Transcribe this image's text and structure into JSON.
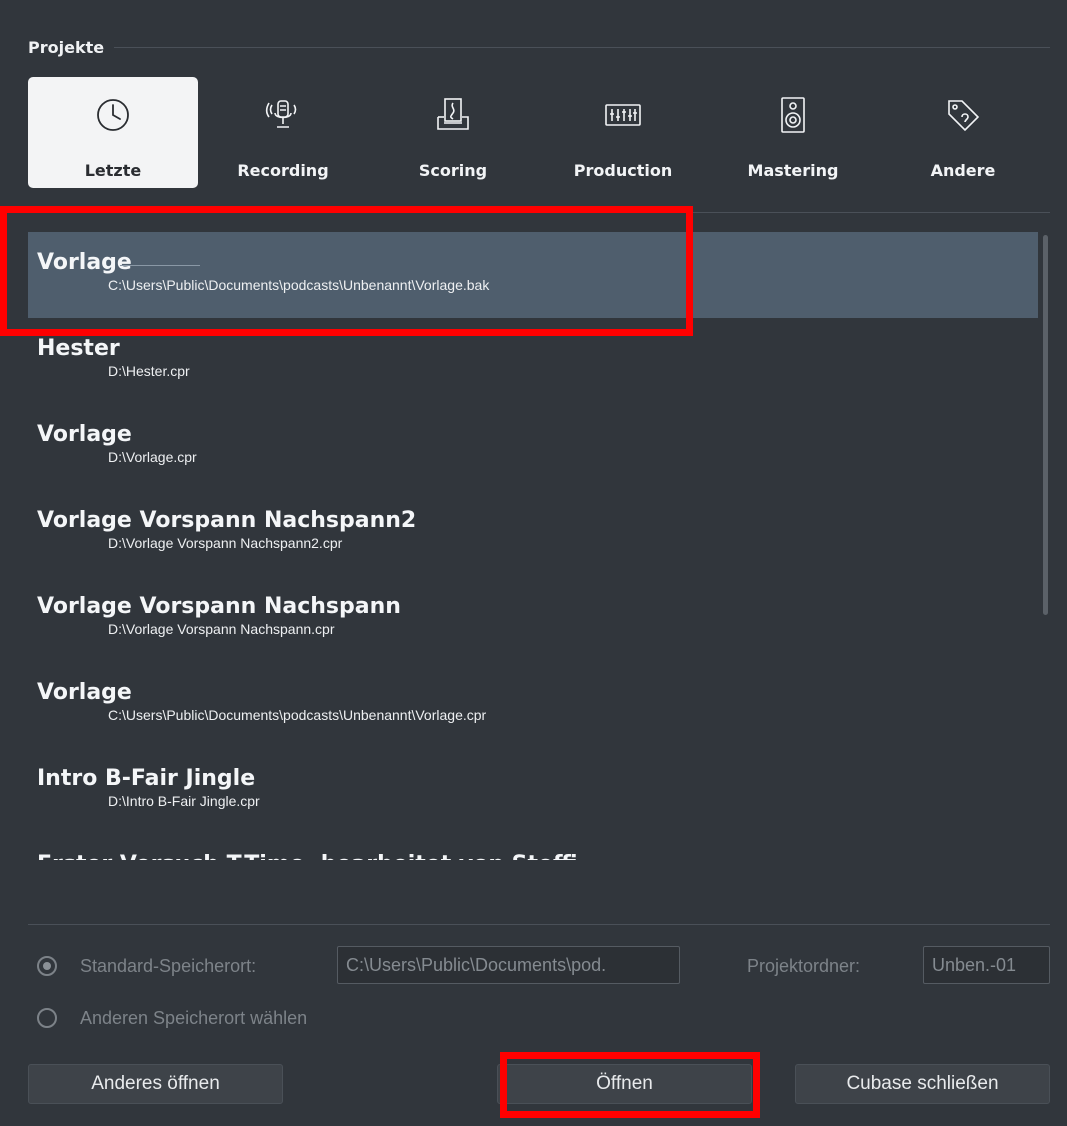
{
  "section": {
    "title": "Projekte"
  },
  "tabs": [
    {
      "label": "Letzte",
      "icon": "clock-icon",
      "active": true
    },
    {
      "label": "Recording",
      "icon": "microphone-icon"
    },
    {
      "label": "Scoring",
      "icon": "music-sheet-icon"
    },
    {
      "label": "Production",
      "icon": "mixer-icon"
    },
    {
      "label": "Mastering",
      "icon": "speaker-icon"
    },
    {
      "label": "Andere",
      "icon": "tag-icon"
    }
  ],
  "projects": [
    {
      "name": "Vorlage",
      "path": "C:\\Users\\Public\\Documents\\podcasts\\Unbenannt\\Vorlage.bak"
    },
    {
      "name": "Hester",
      "path": "D:\\Hester.cpr"
    },
    {
      "name": "Vorlage",
      "path": "D:\\Vorlage.cpr"
    },
    {
      "name": "Vorlage Vorspann Nachspann2",
      "path": "D:\\Vorlage Vorspann Nachspann2.cpr"
    },
    {
      "name": "Vorlage Vorspann Nachspann",
      "path": "D:\\Vorlage Vorspann Nachspann.cpr"
    },
    {
      "name": "Vorlage",
      "path": "C:\\Users\\Public\\Documents\\podcasts\\Unbenannt\\Vorlage.cpr"
    },
    {
      "name": "Intro B-Fair Jingle",
      "path": "D:\\Intro B-Fair Jingle.cpr"
    },
    {
      "name": "Erster Versuch T-Time, bearbeitet von Steffi",
      "path": ""
    }
  ],
  "location": {
    "standard_label": "Standard-Speicherort:",
    "standard_value": "C:\\Users\\Public\\Documents\\pod.",
    "folder_label": "Projektordner:",
    "folder_value": "Unben.-01",
    "other_label": "Anderen Speicherort wählen"
  },
  "buttons": {
    "other_open": "Anderes öffnen",
    "open": "Öffnen",
    "close": "Cubase schließen"
  },
  "colors": {
    "background": "#31363c",
    "selected_row": "#4f5e6d",
    "highlight": "#ff0000"
  }
}
